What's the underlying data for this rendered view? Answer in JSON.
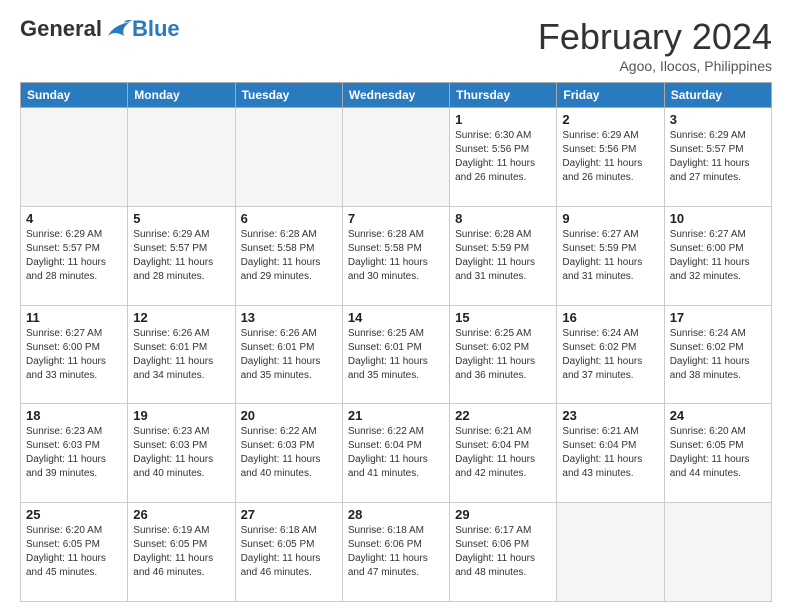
{
  "logo": {
    "general": "General",
    "blue": "Blue"
  },
  "title": "February 2024",
  "location": "Agoo, Ilocos, Philippines",
  "days_of_week": [
    "Sunday",
    "Monday",
    "Tuesday",
    "Wednesday",
    "Thursday",
    "Friday",
    "Saturday"
  ],
  "weeks": [
    [
      {
        "day": "",
        "sunrise": "",
        "sunset": "",
        "daylight": ""
      },
      {
        "day": "",
        "sunrise": "",
        "sunset": "",
        "daylight": ""
      },
      {
        "day": "",
        "sunrise": "",
        "sunset": "",
        "daylight": ""
      },
      {
        "day": "",
        "sunrise": "",
        "sunset": "",
        "daylight": ""
      },
      {
        "day": "1",
        "sunrise": "Sunrise: 6:30 AM",
        "sunset": "Sunset: 5:56 PM",
        "daylight": "Daylight: 11 hours and 26 minutes."
      },
      {
        "day": "2",
        "sunrise": "Sunrise: 6:29 AM",
        "sunset": "Sunset: 5:56 PM",
        "daylight": "Daylight: 11 hours and 26 minutes."
      },
      {
        "day": "3",
        "sunrise": "Sunrise: 6:29 AM",
        "sunset": "Sunset: 5:57 PM",
        "daylight": "Daylight: 11 hours and 27 minutes."
      }
    ],
    [
      {
        "day": "4",
        "sunrise": "Sunrise: 6:29 AM",
        "sunset": "Sunset: 5:57 PM",
        "daylight": "Daylight: 11 hours and 28 minutes."
      },
      {
        "day": "5",
        "sunrise": "Sunrise: 6:29 AM",
        "sunset": "Sunset: 5:57 PM",
        "daylight": "Daylight: 11 hours and 28 minutes."
      },
      {
        "day": "6",
        "sunrise": "Sunrise: 6:28 AM",
        "sunset": "Sunset: 5:58 PM",
        "daylight": "Daylight: 11 hours and 29 minutes."
      },
      {
        "day": "7",
        "sunrise": "Sunrise: 6:28 AM",
        "sunset": "Sunset: 5:58 PM",
        "daylight": "Daylight: 11 hours and 30 minutes."
      },
      {
        "day": "8",
        "sunrise": "Sunrise: 6:28 AM",
        "sunset": "Sunset: 5:59 PM",
        "daylight": "Daylight: 11 hours and 31 minutes."
      },
      {
        "day": "9",
        "sunrise": "Sunrise: 6:27 AM",
        "sunset": "Sunset: 5:59 PM",
        "daylight": "Daylight: 11 hours and 31 minutes."
      },
      {
        "day": "10",
        "sunrise": "Sunrise: 6:27 AM",
        "sunset": "Sunset: 6:00 PM",
        "daylight": "Daylight: 11 hours and 32 minutes."
      }
    ],
    [
      {
        "day": "11",
        "sunrise": "Sunrise: 6:27 AM",
        "sunset": "Sunset: 6:00 PM",
        "daylight": "Daylight: 11 hours and 33 minutes."
      },
      {
        "day": "12",
        "sunrise": "Sunrise: 6:26 AM",
        "sunset": "Sunset: 6:01 PM",
        "daylight": "Daylight: 11 hours and 34 minutes."
      },
      {
        "day": "13",
        "sunrise": "Sunrise: 6:26 AM",
        "sunset": "Sunset: 6:01 PM",
        "daylight": "Daylight: 11 hours and 35 minutes."
      },
      {
        "day": "14",
        "sunrise": "Sunrise: 6:25 AM",
        "sunset": "Sunset: 6:01 PM",
        "daylight": "Daylight: 11 hours and 35 minutes."
      },
      {
        "day": "15",
        "sunrise": "Sunrise: 6:25 AM",
        "sunset": "Sunset: 6:02 PM",
        "daylight": "Daylight: 11 hours and 36 minutes."
      },
      {
        "day": "16",
        "sunrise": "Sunrise: 6:24 AM",
        "sunset": "Sunset: 6:02 PM",
        "daylight": "Daylight: 11 hours and 37 minutes."
      },
      {
        "day": "17",
        "sunrise": "Sunrise: 6:24 AM",
        "sunset": "Sunset: 6:02 PM",
        "daylight": "Daylight: 11 hours and 38 minutes."
      }
    ],
    [
      {
        "day": "18",
        "sunrise": "Sunrise: 6:23 AM",
        "sunset": "Sunset: 6:03 PM",
        "daylight": "Daylight: 11 hours and 39 minutes."
      },
      {
        "day": "19",
        "sunrise": "Sunrise: 6:23 AM",
        "sunset": "Sunset: 6:03 PM",
        "daylight": "Daylight: 11 hours and 40 minutes."
      },
      {
        "day": "20",
        "sunrise": "Sunrise: 6:22 AM",
        "sunset": "Sunset: 6:03 PM",
        "daylight": "Daylight: 11 hours and 40 minutes."
      },
      {
        "day": "21",
        "sunrise": "Sunrise: 6:22 AM",
        "sunset": "Sunset: 6:04 PM",
        "daylight": "Daylight: 11 hours and 41 minutes."
      },
      {
        "day": "22",
        "sunrise": "Sunrise: 6:21 AM",
        "sunset": "Sunset: 6:04 PM",
        "daylight": "Daylight: 11 hours and 42 minutes."
      },
      {
        "day": "23",
        "sunrise": "Sunrise: 6:21 AM",
        "sunset": "Sunset: 6:04 PM",
        "daylight": "Daylight: 11 hours and 43 minutes."
      },
      {
        "day": "24",
        "sunrise": "Sunrise: 6:20 AM",
        "sunset": "Sunset: 6:05 PM",
        "daylight": "Daylight: 11 hours and 44 minutes."
      }
    ],
    [
      {
        "day": "25",
        "sunrise": "Sunrise: 6:20 AM",
        "sunset": "Sunset: 6:05 PM",
        "daylight": "Daylight: 11 hours and 45 minutes."
      },
      {
        "day": "26",
        "sunrise": "Sunrise: 6:19 AM",
        "sunset": "Sunset: 6:05 PM",
        "daylight": "Daylight: 11 hours and 46 minutes."
      },
      {
        "day": "27",
        "sunrise": "Sunrise: 6:18 AM",
        "sunset": "Sunset: 6:05 PM",
        "daylight": "Daylight: 11 hours and 46 minutes."
      },
      {
        "day": "28",
        "sunrise": "Sunrise: 6:18 AM",
        "sunset": "Sunset: 6:06 PM",
        "daylight": "Daylight: 11 hours and 47 minutes."
      },
      {
        "day": "29",
        "sunrise": "Sunrise: 6:17 AM",
        "sunset": "Sunset: 6:06 PM",
        "daylight": "Daylight: 11 hours and 48 minutes."
      },
      {
        "day": "",
        "sunrise": "",
        "sunset": "",
        "daylight": ""
      },
      {
        "day": "",
        "sunrise": "",
        "sunset": "",
        "daylight": ""
      }
    ]
  ]
}
